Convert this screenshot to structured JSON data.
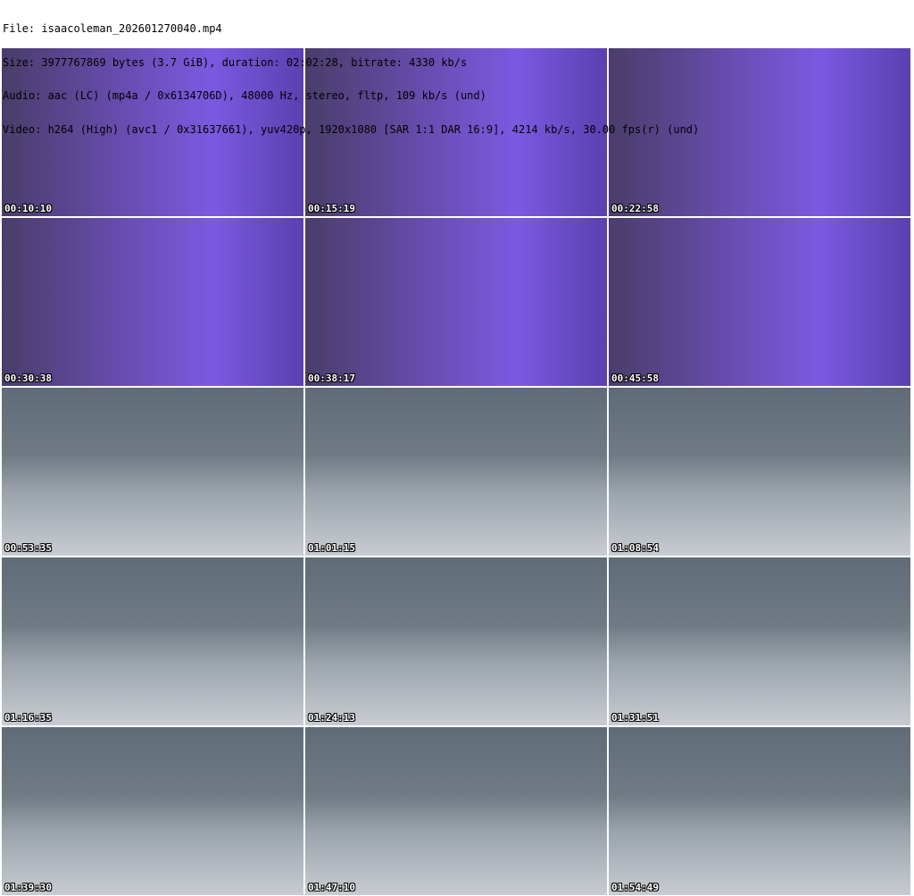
{
  "header": {
    "file": "File: isaacoleman_202601270040.mp4",
    "size": "Size: 3977767869 bytes (3.7 GiB), duration: 02:02:28, bitrate: 4330 kb/s",
    "audio": "Audio: aac (LC) (mp4a / 0x6134706D), 48000 Hz, stereo, fltp, 109 kb/s (und)",
    "video": "Video: h264 (High) (avc1 / 0x31637661), yuv420p, 1920x1080 [SAR 1:1 DAR 16:9], 4214 kb/s, 30.00 fps(r) (und)"
  },
  "thumbnails": [
    {
      "time": "00:10:10",
      "scene": "purple"
    },
    {
      "time": "00:15:19",
      "scene": "purple"
    },
    {
      "time": "00:22:58",
      "scene": "purple"
    },
    {
      "time": "00:30:38",
      "scene": "purple"
    },
    {
      "time": "00:38:17",
      "scene": "purple"
    },
    {
      "time": "00:45:58",
      "scene": "purple"
    },
    {
      "time": "00:53:35",
      "scene": "room"
    },
    {
      "time": "01:01:15",
      "scene": "room"
    },
    {
      "time": "01:08:54",
      "scene": "room"
    },
    {
      "time": "01:16:35",
      "scene": "room"
    },
    {
      "time": "01:24:13",
      "scene": "room"
    },
    {
      "time": "01:31:51",
      "scene": "room"
    },
    {
      "time": "01:39:30",
      "scene": "room"
    },
    {
      "time": "01:47:10",
      "scene": "room"
    },
    {
      "time": "01:54:49",
      "scene": "room"
    }
  ]
}
